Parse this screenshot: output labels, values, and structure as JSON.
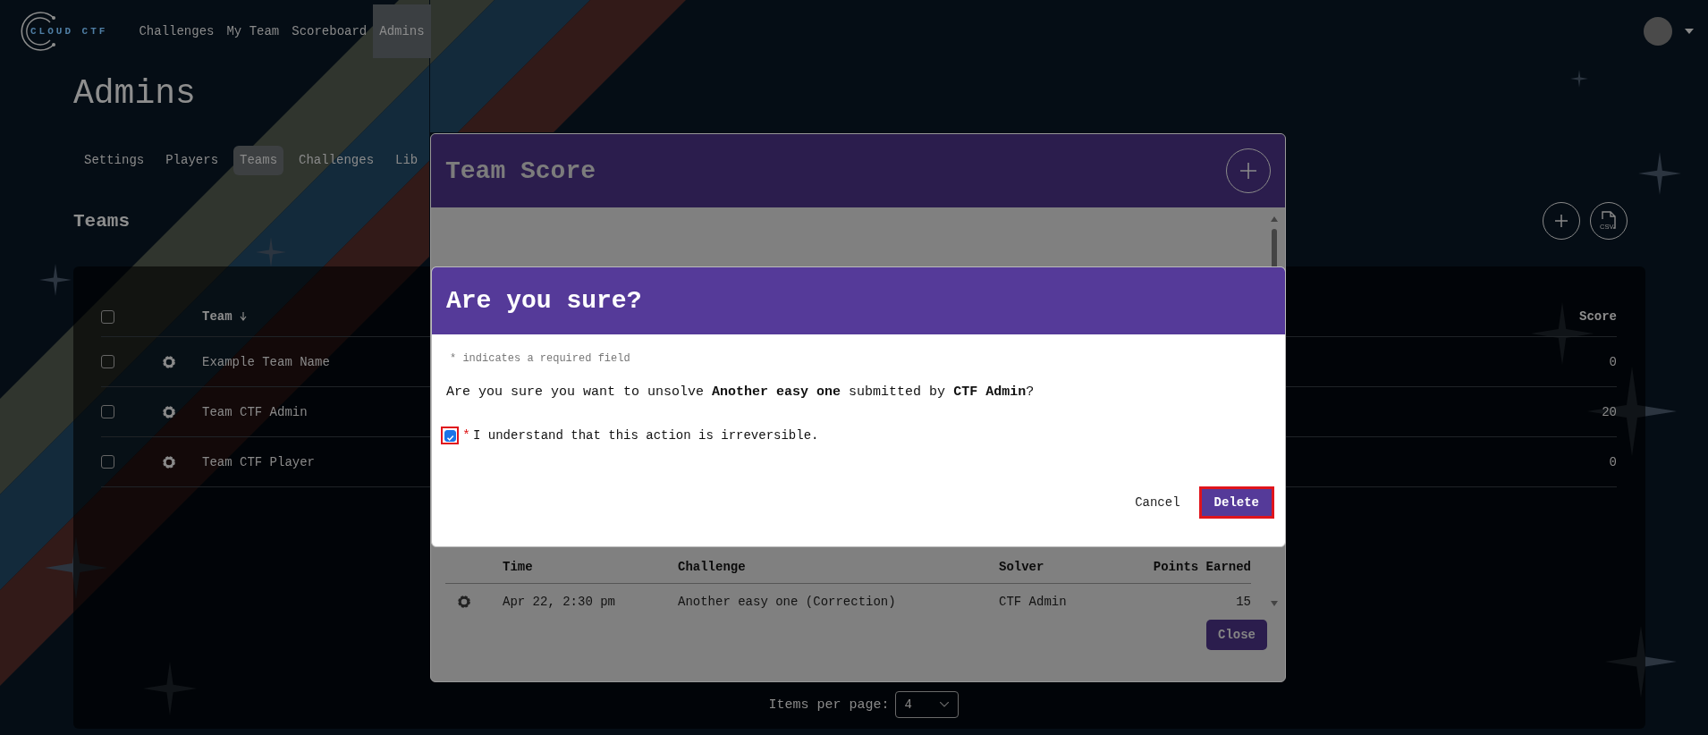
{
  "nav": {
    "logo": "CLOUD CTF",
    "items": [
      {
        "label": "Challenges",
        "selected": false
      },
      {
        "label": "My Team",
        "selected": false
      },
      {
        "label": "Scoreboard",
        "selected": false
      },
      {
        "label": "Admins",
        "selected": true
      }
    ]
  },
  "page_title": "Admins",
  "admin_tabs": [
    {
      "label": "Settings",
      "selected": false
    },
    {
      "label": "Players",
      "selected": false
    },
    {
      "label": "Teams",
      "selected": true
    },
    {
      "label": "Challenges",
      "selected": false
    },
    {
      "label": "Lib",
      "selected": false
    }
  ],
  "section_title": "Teams",
  "export_icon_text": "CSV",
  "teams_table": {
    "select_all_checked": false,
    "columns": [
      "Team",
      "Score"
    ],
    "rows": [
      {
        "checked": false,
        "team": "Example Team Name",
        "score": "0"
      },
      {
        "checked": false,
        "team": "Team CTF Admin",
        "score": "20"
      },
      {
        "checked": false,
        "team": "Team CTF Player",
        "score": "0"
      }
    ]
  },
  "pagination": {
    "label": "Items per page:",
    "value": "4"
  },
  "team_score_modal": {
    "title": "Team Score",
    "columns": [
      "Time",
      "Challenge",
      "Solver",
      "Points Earned"
    ],
    "rows": [
      {
        "time": "Apr 22, 2:30 pm",
        "challenge": "Another easy one (Correction)",
        "solver": "CTF Admin",
        "points": "15"
      }
    ],
    "close": "Close"
  },
  "confirm_dialog": {
    "title": "Are you sure?",
    "required_note": "* indicates a required field",
    "message": "Are you sure you want to unsolve **Another easy one** submitted by **CTF Admin**?",
    "acknowledge": {
      "checked": true,
      "required_mark": "*",
      "label": "I understand that this action is irreversible."
    },
    "buttons": [
      {
        "label": "Cancel",
        "kind": "plain"
      },
      {
        "label": "Delete",
        "kind": "primary"
      }
    ]
  }
}
